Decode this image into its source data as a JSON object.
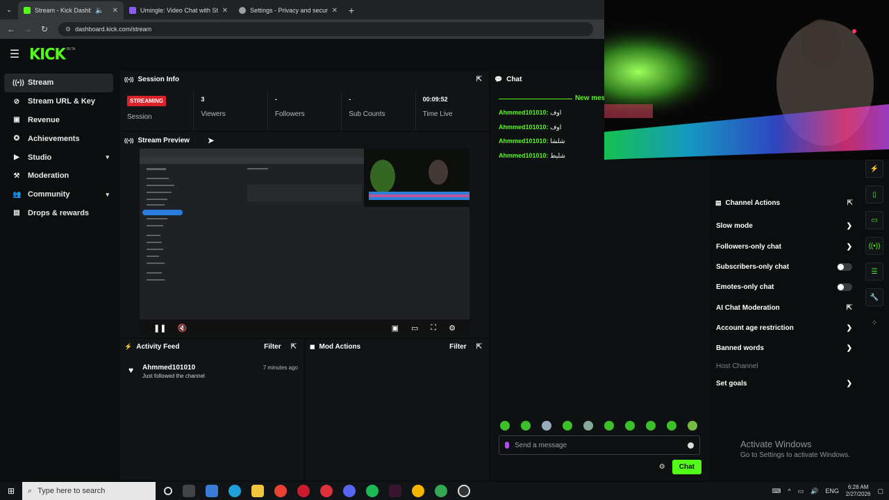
{
  "browser": {
    "tabs": [
      {
        "title": "Stream - Kick Dashboard",
        "fav": "#53fc18"
      },
      {
        "title": "Umingle: Video Chat with Stra",
        "fav": "#8b5cf6"
      },
      {
        "title": "Settings - Privacy and security",
        "fav": "#9aa0a6"
      }
    ],
    "url": "dashboard.kick.com/stream"
  },
  "brand": {
    "logo": "KICK",
    "beta": "BETA",
    "accent": "#53fc18"
  },
  "sidebar": {
    "items": [
      {
        "label": "Stream",
        "icon": "broadcast-icon"
      },
      {
        "label": "Stream URL & Key",
        "icon": "link-icon"
      },
      {
        "label": "Revenue",
        "icon": "dollar-icon"
      },
      {
        "label": "Achievements",
        "icon": "medal-icon"
      },
      {
        "label": "Studio",
        "icon": "video-icon"
      },
      {
        "label": "Moderation",
        "icon": "hammer-icon"
      },
      {
        "label": "Community",
        "icon": "users-icon"
      },
      {
        "label": "Drops & rewards",
        "icon": "gift-icon"
      }
    ]
  },
  "session": {
    "title": "Session Info",
    "badge": "STREAMING",
    "session_label": "Session",
    "viewers_value": "3",
    "viewers_label": "Viewers",
    "followers_value": "-",
    "followers_label": "Followers",
    "subs_value": "-",
    "subs_label": "Sub Counts",
    "time_value": "00:09:52",
    "time_label": "Time Live"
  },
  "preview": {
    "title": "Stream Preview"
  },
  "activity": {
    "title": "Activity Feed",
    "filter": "Filter",
    "items": [
      {
        "name": "Ahmmed101010",
        "desc": "Just followed the channel",
        "ago": "7 minutes ago"
      }
    ]
  },
  "mod_actions": {
    "title": "Mod Actions",
    "filter": "Filter"
  },
  "chat": {
    "title": "Chat",
    "new_messages": "New mes",
    "messages": [
      {
        "user": "Ahmmed101010:",
        "text": "اوف"
      },
      {
        "user": "Ahmmed101010:",
        "text": "اوف"
      },
      {
        "user": "Ahmmed101010:",
        "text": "شلشا"
      },
      {
        "user": "Ahmmed101010:",
        "text": "شليط"
      }
    ],
    "placeholder": "Send a message",
    "send": "Chat"
  },
  "channel_actions": {
    "title": "Channel Actions",
    "items": [
      {
        "label": "Slow mode",
        "control": "arrow"
      },
      {
        "label": "Followers-only chat",
        "control": "arrow"
      },
      {
        "label": "Subscribers-only chat",
        "control": "toggle"
      },
      {
        "label": "Emotes-only chat",
        "control": "toggle"
      },
      {
        "label": "AI Chat Moderation",
        "control": "external"
      },
      {
        "label": "Account age restriction",
        "control": "arrow"
      },
      {
        "label": "Banned words",
        "control": "arrow"
      },
      {
        "label": "Host Channel",
        "control": "none"
      },
      {
        "label": "Set goals",
        "control": "arrow"
      }
    ]
  },
  "watermark": {
    "line1": "Activate Windows",
    "line2": "Go to Settings to activate Windows."
  },
  "taskbar": {
    "search_placeholder": "Type here to search",
    "lang": "ENG",
    "time": "6:28 AM",
    "date": "2/27/2026"
  }
}
